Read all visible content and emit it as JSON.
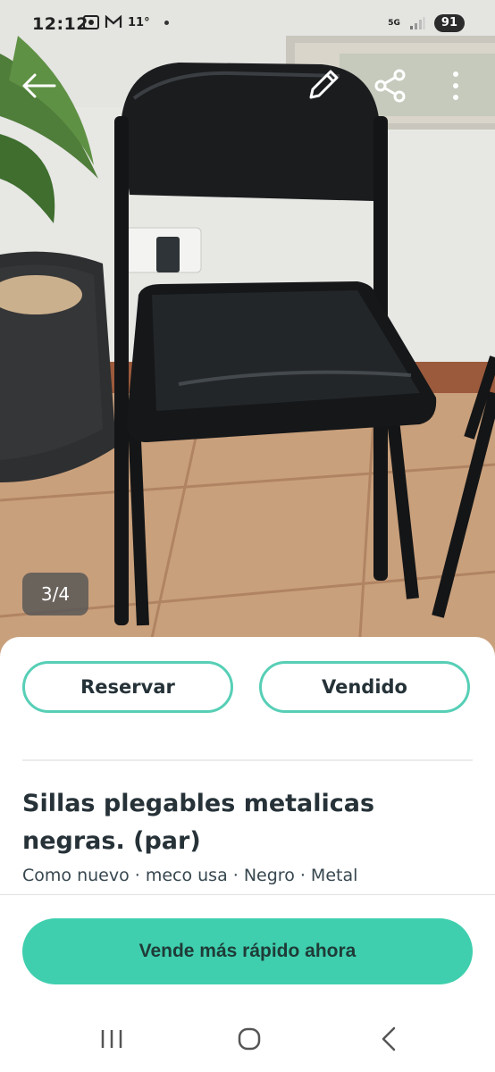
{
  "status_bar": {
    "time": "12:12",
    "temperature": "11°",
    "network": "5G",
    "battery": "91"
  },
  "toolbar": {
    "back_icon": "arrow-left-icon",
    "edit_icon": "pencil-icon",
    "share_icon": "share-icon",
    "more_icon": "more-vertical-icon"
  },
  "gallery": {
    "counter": "3/4"
  },
  "actions": {
    "reserve_label": "Reservar",
    "sold_label": "Vendido"
  },
  "listing": {
    "title": "Sillas plegables metalicas negras. (par)",
    "details": "Como nuevo · meco usa · Negro · Metal"
  },
  "promo": {
    "cta_label": "Vende más rápido ahora"
  },
  "colors": {
    "accent": "#57cfb6",
    "cta_background": "#3fcfae"
  },
  "nav_bar": {
    "recents_icon": "recent-apps-icon",
    "home_icon": "home-icon",
    "back_icon": "nav-back-icon"
  }
}
